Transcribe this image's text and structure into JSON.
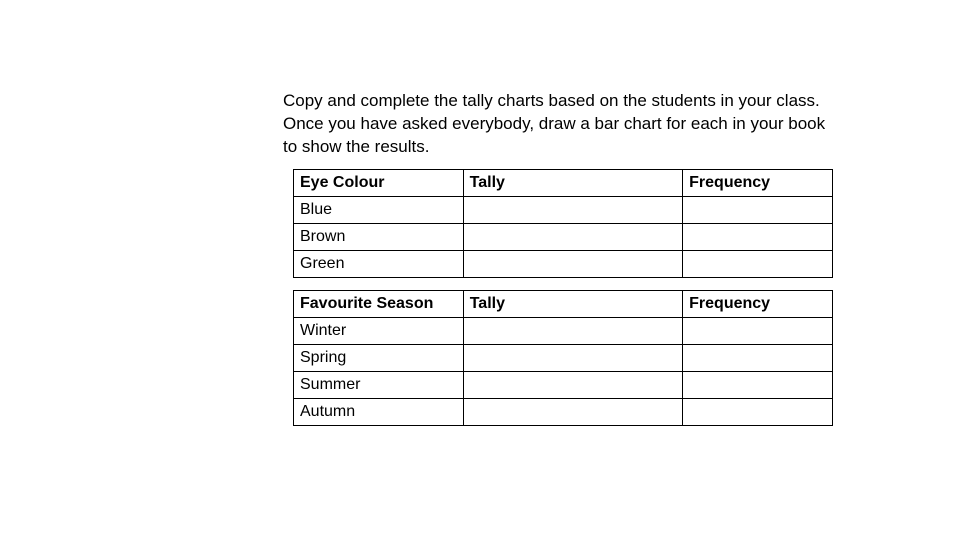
{
  "instruction": "Copy and complete the tally charts based on the students in your class. Once you have asked everybody, draw a bar chart for each in your book to show the results.",
  "tables": [
    {
      "headers": [
        "Eye Colour",
        "Tally",
        "Frequency"
      ],
      "rows": [
        {
          "label": "Blue",
          "tally": "",
          "freq": ""
        },
        {
          "label": "Brown",
          "tally": "",
          "freq": ""
        },
        {
          "label": "Green",
          "tally": "",
          "freq": ""
        }
      ]
    },
    {
      "headers": [
        "Favourite Season",
        "Tally",
        "Frequency"
      ],
      "rows": [
        {
          "label": "Winter",
          "tally": "",
          "freq": ""
        },
        {
          "label": "Spring",
          "tally": "",
          "freq": ""
        },
        {
          "label": "Summer",
          "tally": "",
          "freq": ""
        },
        {
          "label": "Autumn",
          "tally": "",
          "freq": ""
        }
      ]
    }
  ],
  "chart_data": [
    {
      "type": "table",
      "title": "Eye Colour",
      "columns": [
        "Eye Colour",
        "Tally",
        "Frequency"
      ],
      "rows": [
        [
          "Blue",
          "",
          ""
        ],
        [
          "Brown",
          "",
          ""
        ],
        [
          "Green",
          "",
          ""
        ]
      ]
    },
    {
      "type": "table",
      "title": "Favourite Season",
      "columns": [
        "Favourite Season",
        "Tally",
        "Frequency"
      ],
      "rows": [
        [
          "Winter",
          "",
          ""
        ],
        [
          "Spring",
          "",
          ""
        ],
        [
          "Summer",
          "",
          ""
        ],
        [
          "Autumn",
          "",
          ""
        ]
      ]
    }
  ]
}
